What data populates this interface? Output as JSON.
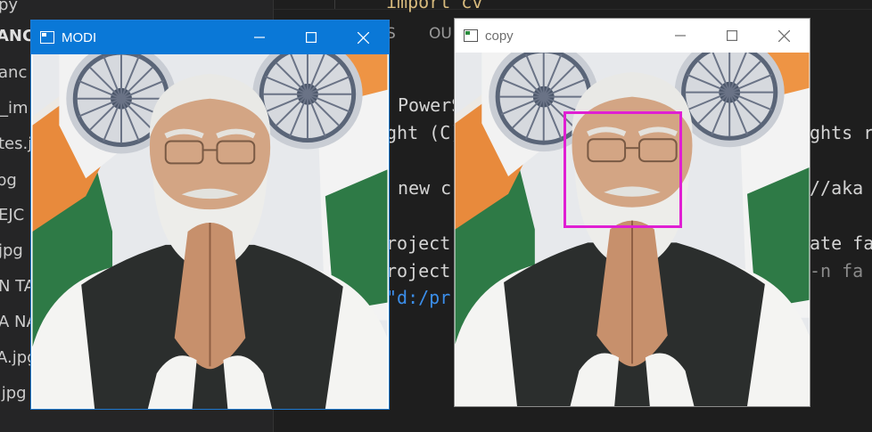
{
  "explorer": {
    "items": [
      "py",
      "ANCE",
      "anc",
      "_im",
      "tes.j",
      "pg",
      "EJC",
      "jpg",
      "N TA",
      "A NA",
      "A.jpg",
      ".jpg"
    ]
  },
  "editor": {
    "tabs": [
      "S",
      "OU"
    ],
    "lines": {
      "import": "import cv",
      "powershell": "PowerS",
      "copyright": "ght (C)",
      "rights": "ghts r",
      "new": "new c",
      "aka": "//aka",
      "project1": "roject",
      "fa1": "ate fa",
      "project2": "roject",
      "fa2": "-n fa",
      "path": "\"d:/pr"
    }
  },
  "windows": {
    "modi": {
      "title": "MODI"
    },
    "copy": {
      "title": "copy"
    }
  },
  "colors": {
    "active_titlebar": "#0a78d7",
    "face_box": "#e01fd3",
    "editor_bg": "#1e1e1e"
  },
  "icons": {
    "app": "window-app-icon",
    "minimize": "minimize-icon",
    "maximize": "maximize-icon",
    "close": "close-icon"
  }
}
